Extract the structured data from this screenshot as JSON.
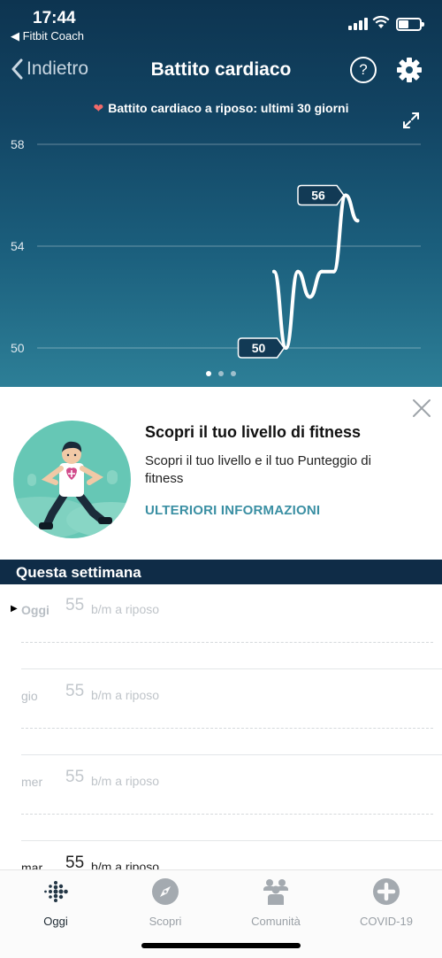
{
  "status_bar": {
    "time": "17:44",
    "back_app": "◀ Fitbit Coach"
  },
  "nav": {
    "back_label": "Indietro",
    "title": "Battito cardiaco",
    "help_label": "?"
  },
  "subtitle": "Battito cardiaco a riposo: ultimi 30 giorni",
  "chart_data": {
    "type": "line",
    "y_ticks": [
      "58",
      "54",
      "50"
    ],
    "ylim": [
      48,
      58
    ],
    "grid": true,
    "x": [
      1,
      2,
      3,
      4,
      5,
      6,
      7,
      8
    ],
    "values": [
      53,
      50,
      53,
      52,
      53,
      53,
      56,
      55
    ],
    "annotations": [
      {
        "label": "50",
        "value": 50
      },
      {
        "label": "56",
        "value": 56
      }
    ],
    "line_color": "#ffffff"
  },
  "pager": {
    "count": 3,
    "active": 0
  },
  "promo": {
    "title": "Scopri il tuo livello di fitness",
    "text": "Scopri il tuo livello e il tuo Punteggio di fitness",
    "link": "ULTERIORI INFORMAZIONI"
  },
  "week": {
    "header": "Questa settimana",
    "rows": [
      {
        "day": "Oggi",
        "value": "55",
        "unit": "b/m a riposo"
      },
      {
        "day": "gio",
        "value": "55",
        "unit": "b/m a riposo"
      },
      {
        "day": "mer",
        "value": "55",
        "unit": "b/m a riposo"
      },
      {
        "day": "mar",
        "value": "55",
        "unit": "b/m a riposo"
      }
    ]
  },
  "tabs": [
    {
      "label": "Oggi",
      "icon": "fitbit-dots-icon"
    },
    {
      "label": "Scopri",
      "icon": "compass-icon"
    },
    {
      "label": "Comunità",
      "icon": "community-icon"
    },
    {
      "label": "COVID-19",
      "icon": "plus-circle-icon"
    }
  ],
  "colors": {
    "header_top": "#0d3450",
    "header_bottom": "#2d7f97",
    "accent_link": "#3a8fa3",
    "heart": "#f06a6a",
    "week_header": "#0f2c47"
  }
}
